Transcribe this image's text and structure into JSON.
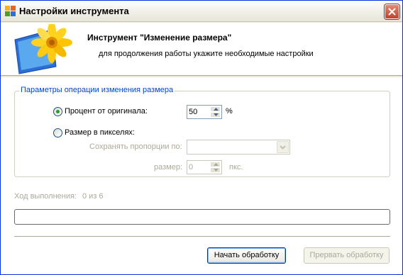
{
  "window": {
    "title": "Настройки инструмента"
  },
  "header": {
    "title": "Инструмент \"Изменение размера\"",
    "subtitle": "для продолжения работы укажите необходимые настройки"
  },
  "group": {
    "legend": "Параметры операции изменения размера",
    "percent": {
      "label": "Процент от оригинала:",
      "value": "50",
      "unit": "%",
      "selected": true
    },
    "pixels": {
      "label": "Размер в пикселях:",
      "selected": false,
      "keep_ratio_label": "Сохранять пропорции по:",
      "keep_ratio_value": "",
      "size_label": "размер:",
      "size_value": "0",
      "size_unit": "пкс."
    }
  },
  "progress": {
    "label": "Ход выполнения:",
    "value": "0 из 6",
    "fraction": 0
  },
  "buttons": {
    "start": "Начать обработку",
    "stop": "Прервать обработку"
  }
}
